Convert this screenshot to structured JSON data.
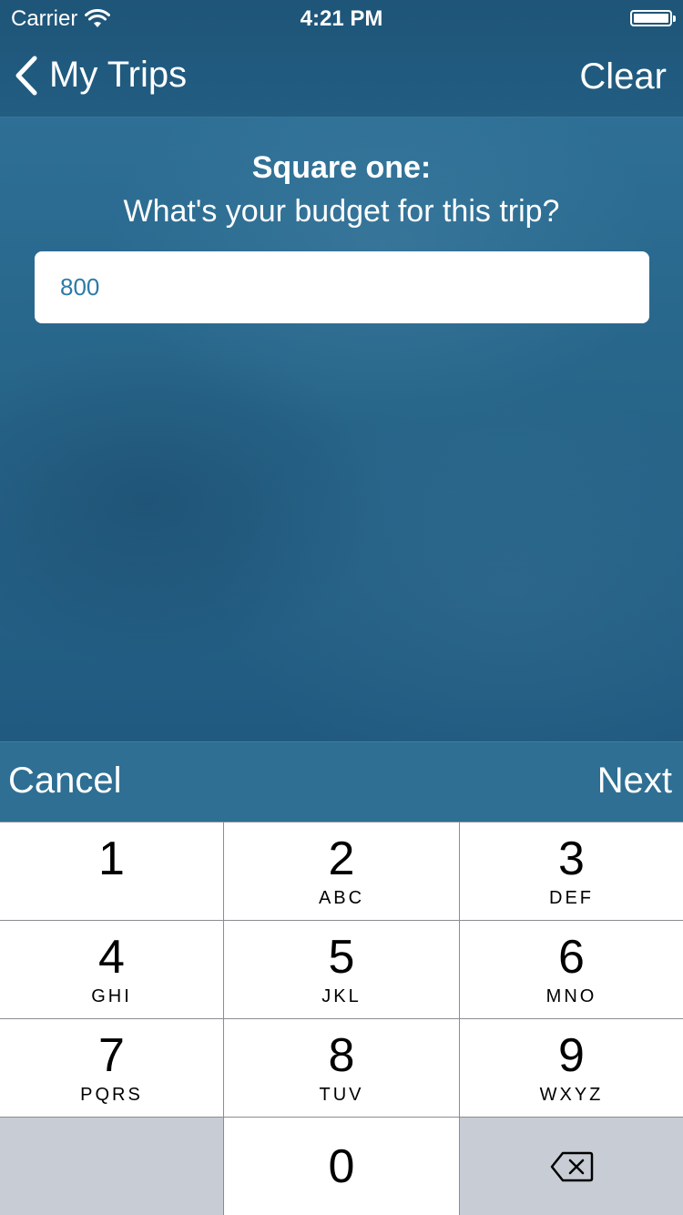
{
  "status_bar": {
    "carrier": "Carrier",
    "time": "4:21 PM"
  },
  "nav": {
    "back_label": "My Trips",
    "clear_label": "Clear"
  },
  "prompt": {
    "title": "Square one:",
    "subtitle": "What's your budget for this trip?"
  },
  "budget_field": {
    "value": "800"
  },
  "accessory": {
    "cancel_label": "Cancel",
    "next_label": "Next"
  },
  "keypad": {
    "keys": [
      {
        "digit": "1",
        "letters": ""
      },
      {
        "digit": "2",
        "letters": "ABC"
      },
      {
        "digit": "3",
        "letters": "DEF"
      },
      {
        "digit": "4",
        "letters": "GHI"
      },
      {
        "digit": "5",
        "letters": "JKL"
      },
      {
        "digit": "6",
        "letters": "MNO"
      },
      {
        "digit": "7",
        "letters": "PQRS"
      },
      {
        "digit": "8",
        "letters": "TUV"
      },
      {
        "digit": "9",
        "letters": "WXYZ"
      },
      {
        "digit": "0",
        "letters": ""
      }
    ],
    "delete_icon": "backspace-icon"
  },
  "colors": {
    "nav_background": "#1e5578",
    "content_background": "#276589",
    "accessory_background": "#2e6f93",
    "input_text": "#2a7ba6",
    "key_background": "#ffffff",
    "key_dark_background": "#c8cdd5"
  }
}
